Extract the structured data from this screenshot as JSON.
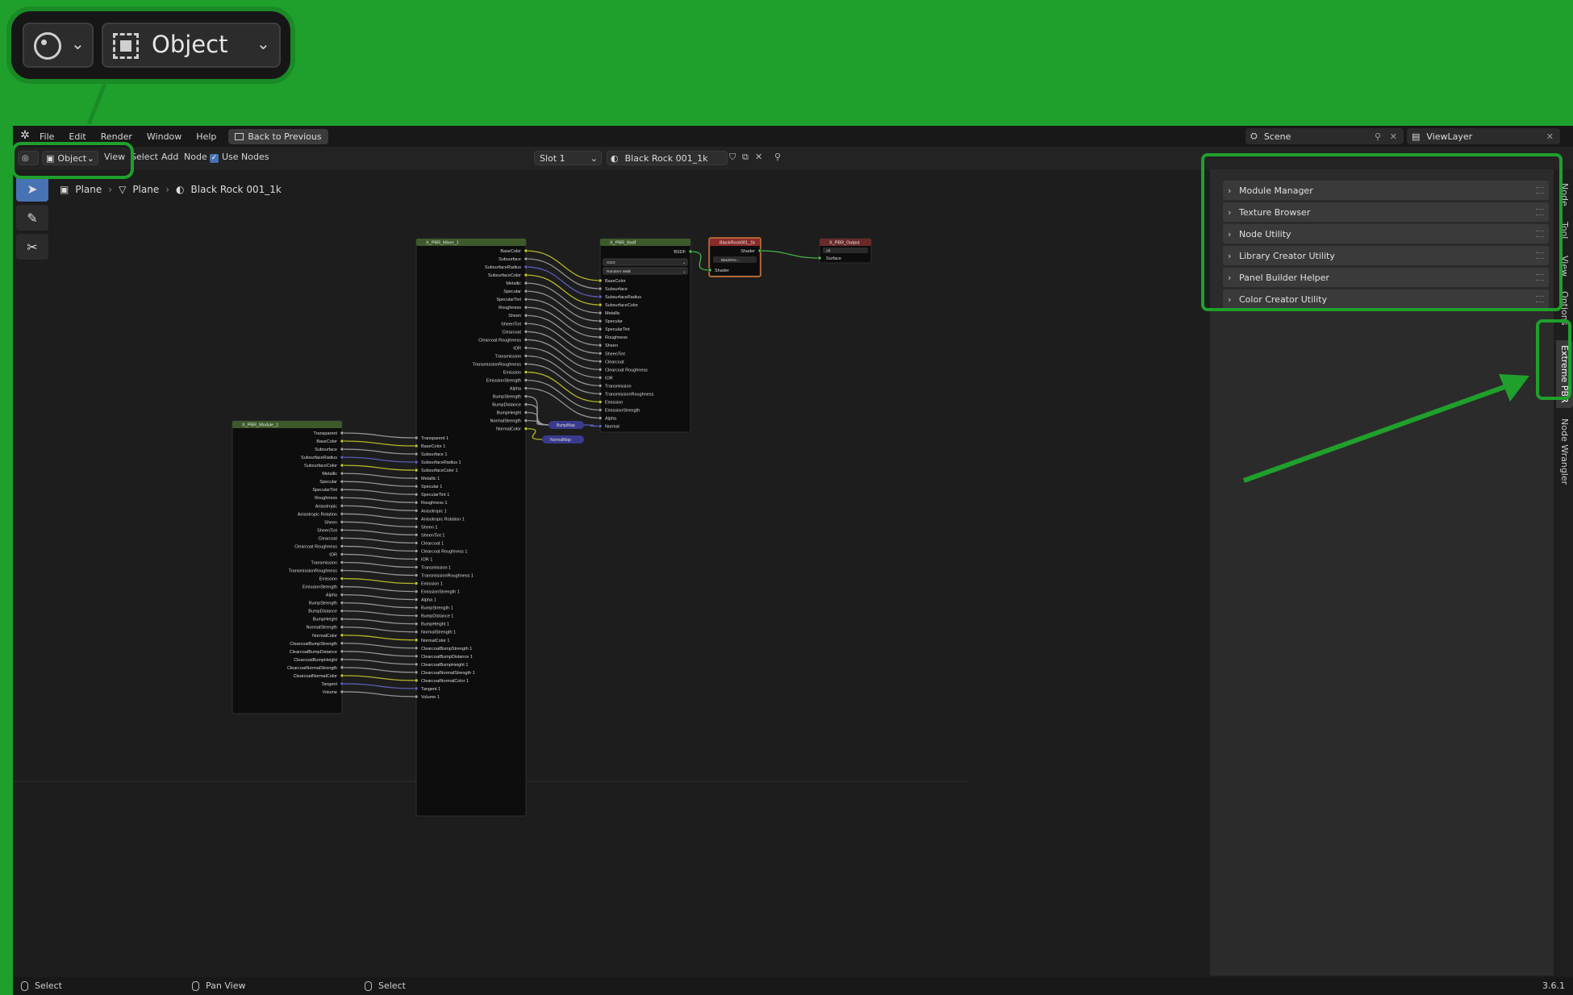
{
  "zoom_callout": {
    "mode_label": "Object"
  },
  "topbar": {
    "menus": [
      "File",
      "Edit",
      "Render",
      "Window",
      "Help"
    ],
    "back_button": "Back to Previous",
    "scene": "Scene",
    "view_layer": "ViewLayer"
  },
  "header": {
    "mode": "Object",
    "menus": [
      "View",
      "Select",
      "Add",
      "Node"
    ],
    "use_nodes_label": "Use Nodes",
    "slot": "Slot 1",
    "material": "Black Rock 001_1k"
  },
  "breadcrumb": [
    "Plane",
    "Plane",
    "Black Rock 001_1k"
  ],
  "sidebar": {
    "panels": [
      "Module Manager",
      "Texture Browser",
      "Node Utility",
      "Library Creator Utility",
      "Panel Builder Helper",
      "Color Creator Utility"
    ],
    "tabs": [
      "Node",
      "Tool",
      "View",
      "Options",
      "Extreme PBR",
      "Node Wrangler"
    ],
    "active_tab": "Extreme PBR"
  },
  "nodes": {
    "module": {
      "title": "X_PBR_Module_1",
      "outputs": [
        "Transparent",
        "BaseColor",
        "Subsurface",
        "SubsurfaceRadius",
        "SubsurfaceColor",
        "Metallic",
        "Specular",
        "SpecularTint",
        "Roughness",
        "Anisotropic",
        "Anisotropic Rotation",
        "Sheen",
        "SheenTint",
        "Clearcoat",
        "Clearcoat Roughness",
        "IOR",
        "Transmission",
        "TransmissionRoughness",
        "Emission",
        "EmissionStrength",
        "Alpha",
        "BumpStrength",
        "BumpDistance",
        "BumpHeight",
        "NormalStrength",
        "NormalColor",
        "ClearcoatBumpStrength",
        "ClearcoatBumpDistance",
        "ClearcoatBumpHeight",
        "ClearcoatNormalStrength",
        "ClearcoatNormalColor",
        "Tangent",
        "Volume"
      ]
    },
    "mixer": {
      "title": "X_PBR_Mixer_1",
      "outputs": [
        "BaseColor",
        "Subsurface",
        "SubsurfaceRadius",
        "SubsurfaceColor",
        "Metallic",
        "Specular",
        "SpecularTint",
        "Roughness",
        "Sheen",
        "SheenTint",
        "Clearcoat",
        "Clearcoat Roughness",
        "IOR",
        "Transmission",
        "TransmissionRoughness",
        "Emission",
        "EmissionStrength",
        "Alpha",
        "BumpStrength",
        "BumpDistance",
        "BumpHeight",
        "NormalStrength",
        "NormalColor"
      ],
      "inputs": [
        "Transparent 1",
        "BaseColor 1",
        "Subsurface 1",
        "SubsurfaceRadius 1",
        "SubsurfaceColor 1",
        "Metallic 1",
        "Specular 1",
        "SpecularTint 1",
        "Roughness 1",
        "Anisotropic 1",
        "Anisotropic Rotation 1",
        "Sheen 1",
        "SheenTint 1",
        "Clearcoat 1",
        "Clearcoat Roughness 1",
        "IOR 1",
        "Transmission 1",
        "TransmissionRoughness 1",
        "Emission 1",
        "EmissionStrength 1",
        "Alpha 1",
        "BumpStrength 1",
        "BumpDistance 1",
        "BumpHeight 1",
        "NormalStrength 1",
        "NormalColor 1",
        "ClearcoatBumpStrength 1",
        "ClearcoatBumpDistance 1",
        "ClearcoatBumpHeight 1",
        "ClearcoatNormalStrength 1",
        "ClearcoatNormalColor 1",
        "Tangent 1",
        "Volume 1"
      ]
    },
    "bsdf": {
      "title": "X_PBR_Bsdf",
      "output": "BSDF",
      "dropdowns": [
        "GGX",
        "Random Walk"
      ],
      "inputs": [
        "BaseColor",
        "Subsurface",
        "SubsurfaceRadius",
        "SubsurfaceColor",
        "Metallic",
        "Specular",
        "SpecularTint",
        "Roughness",
        "Sheen",
        "SheenTint",
        "Clearcoat",
        "Clearcoat Roughness",
        "IOR",
        "Transmission",
        "TransmissionRoughness",
        "Emission",
        "EmissionStrength",
        "Alpha",
        "Normal"
      ]
    },
    "group": {
      "title": "BlackRock001_1k",
      "output": "Shader",
      "datablock": "BlackRoc...",
      "input": "Shader"
    },
    "output": {
      "title": "X_PBR_Output",
      "target": "All",
      "input": "Surface"
    },
    "bump": {
      "label": "BumpMap"
    },
    "normal": {
      "label": "NormalMap"
    }
  },
  "statusbar": {
    "items": [
      "Select",
      "Pan View",
      "Select"
    ],
    "version": "3.6.1"
  }
}
